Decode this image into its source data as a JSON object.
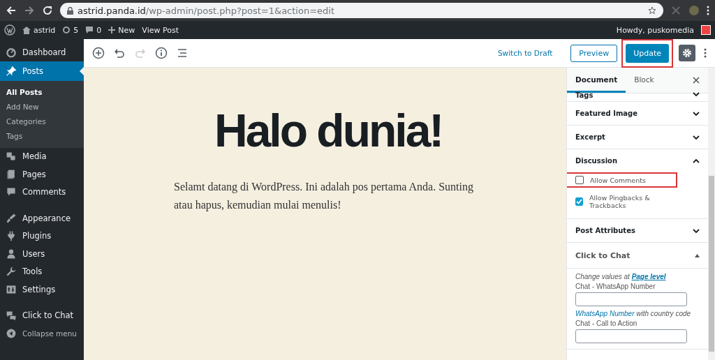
{
  "browser": {
    "url_host": "astrid.panda.id",
    "url_path": "/wp-admin/post.php?post=1&action=edit"
  },
  "admin_bar": {
    "site": "astrid",
    "updates": "5",
    "comments": "0",
    "new": "New",
    "view": "View Post",
    "greeting": "Howdy, puskomedia"
  },
  "sidebar": {
    "groups": [
      [
        {
          "label": "Dashboard",
          "selected": false
        },
        {
          "label": "Posts",
          "selected": true,
          "children": [
            {
              "label": "All Posts",
              "selected": true
            },
            {
              "label": "Add New",
              "selected": false
            },
            {
              "label": "Categories",
              "selected": false
            },
            {
              "label": "Tags",
              "selected": false
            }
          ]
        },
        {
          "label": "Media",
          "selected": false
        },
        {
          "label": "Pages",
          "selected": false
        },
        {
          "label": "Comments",
          "selected": false
        }
      ],
      [
        {
          "label": "Appearance",
          "selected": false
        },
        {
          "label": "Plugins",
          "selected": false
        },
        {
          "label": "Users",
          "selected": false
        },
        {
          "label": "Tools",
          "selected": false
        },
        {
          "label": "Settings",
          "selected": false
        }
      ],
      [
        {
          "label": "Click to Chat",
          "selected": false
        },
        {
          "label": "Collapse menu",
          "selected": false,
          "kind": "collapse"
        }
      ]
    ]
  },
  "toolbar": {
    "switch_draft": "Switch to Draft",
    "preview": "Preview",
    "update": {
      "label": "Update",
      "highlighted": true
    }
  },
  "post": {
    "title": "Halo dunia!",
    "body": "Selamt datang di WordPress. Ini adalah pos pertama Anda. Sunting atau hapus, kemudian mulai menulis!"
  },
  "panel": {
    "tabs": [
      {
        "label": "Document",
        "selected": true
      },
      {
        "label": "Block",
        "selected": false
      }
    ],
    "sections": [
      {
        "title": "Tags",
        "expanded": false,
        "kind": "panel"
      },
      {
        "title": "Featured Image",
        "expanded": false,
        "kind": "panel"
      },
      {
        "title": "Excerpt",
        "expanded": false,
        "kind": "panel"
      },
      {
        "title": "Discussion",
        "expanded": true,
        "kind": "panel",
        "options": [
          {
            "label": "Allow Comments",
            "checked": false,
            "highlighted": true
          },
          {
            "label": "Allow Pingbacks & Trackbacks",
            "checked": true,
            "highlighted": false
          }
        ]
      },
      {
        "title": "Post Attributes",
        "expanded": false,
        "kind": "panel"
      },
      {
        "title": "Click to Chat",
        "expanded": true,
        "kind": "metabox",
        "chat": {
          "note": "Change values at ",
          "note_link": "Page level",
          "number_label": "Chat - WhatsApp Number",
          "number_help_link": "WhatsApp Number",
          "number_help": " with country code",
          "cta_label": "Chat - Call to Action"
        }
      }
    ]
  }
}
